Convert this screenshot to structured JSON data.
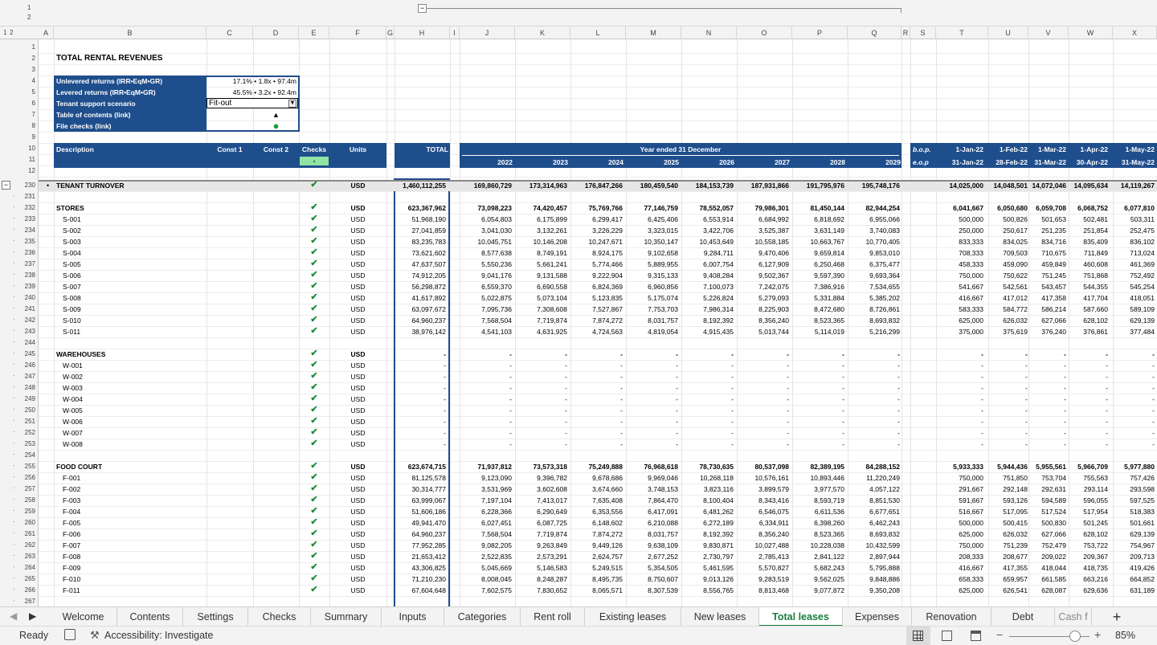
{
  "outline_levels": [
    "1",
    "2"
  ],
  "row_levels": [
    "1",
    "2"
  ],
  "columns": [
    "A",
    "B",
    "C",
    "D",
    "E",
    "F",
    "G",
    "H",
    "I",
    "J",
    "K",
    "L",
    "M",
    "N",
    "O",
    "P",
    "Q",
    "R",
    "S",
    "T",
    "U",
    "V",
    "W",
    "X"
  ],
  "title": "TOTAL RENTAL REVENUES",
  "summary": {
    "rows": [
      {
        "rownum": "4",
        "label": "Unlevered returns (IRR•EqM•GR)",
        "value": "17.1% • 1.8x • 97.4m"
      },
      {
        "rownum": "5",
        "label": "Levered returns (IRR•EqM•GR)",
        "value": "45.5% • 3.2x • 92.4m"
      },
      {
        "rownum": "6",
        "label": "Tenant support scenario",
        "value": "Fit-out"
      },
      {
        "rownum": "7",
        "label": "Table of contents (link)",
        "value": "▲"
      },
      {
        "rownum": "8",
        "label": "File checks (link)",
        "value": "●"
      }
    ]
  },
  "header": {
    "description": "Description",
    "const1": "Const 1",
    "const2": "Const 2",
    "checks": "Checks",
    "units": "Units",
    "total": "TOTAL",
    "year_ended": "Year ended 31 December",
    "check_status": "-",
    "years": [
      "2022",
      "2023",
      "2024",
      "2025",
      "2026",
      "2027",
      "2028",
      "2029"
    ],
    "bop": "b.o.p.",
    "eop": "e.o.p",
    "month_starts": [
      "1-Jan-22",
      "1-Feb-22",
      "1-Mar-22",
      "1-Apr-22",
      "1-May-22"
    ],
    "month_ends": [
      "31-Jan-22",
      "28-Feb-22",
      "31-Mar-22",
      "30-Apr-22",
      "31-May-22"
    ]
  },
  "top_rows": [
    "1",
    "2",
    "3",
    "4",
    "5",
    "6",
    "7",
    "8",
    "9",
    "10",
    "11",
    "12"
  ],
  "rows": [
    {
      "n": "230",
      "label": "TENANT TURNOVER",
      "bold": true,
      "bullet": true,
      "check": true,
      "units": "USD",
      "total": "1,460,112,255",
      "years": [
        "169,860,729",
        "173,314,963",
        "176,847,266",
        "180,459,540",
        "184,153,739",
        "187,931,866",
        "191,795,976",
        "195,748,176"
      ],
      "months": [
        "14,025,000",
        "14,048,501",
        "14,072,046",
        "14,095,634",
        "14,119,267"
      ]
    },
    {
      "n": "231"
    },
    {
      "n": "232",
      "label": "STORES",
      "bold": true,
      "check": true,
      "units": "USD",
      "total": "623,367,962",
      "years": [
        "73,098,223",
        "74,420,457",
        "75,769,766",
        "77,146,759",
        "78,552,057",
        "79,986,301",
        "81,450,144",
        "82,944,254"
      ],
      "months": [
        "6,041,667",
        "6,050,680",
        "6,059,708",
        "6,068,752",
        "6,077,810"
      ]
    },
    {
      "n": "233",
      "label": "S-001",
      "check": true,
      "units": "USD",
      "total": "51,968,190",
      "years": [
        "6,054,803",
        "6,175,899",
        "6,299,417",
        "6,425,406",
        "6,553,914",
        "6,684,992",
        "6,818,692",
        "6,955,066"
      ],
      "months": [
        "500,000",
        "500,826",
        "501,653",
        "502,481",
        "503,311"
      ]
    },
    {
      "n": "234",
      "label": "S-002",
      "check": true,
      "units": "USD",
      "total": "27,041,859",
      "years": [
        "3,041,030",
        "3,132,261",
        "3,226,229",
        "3,323,015",
        "3,422,706",
        "3,525,387",
        "3,631,149",
        "3,740,083"
      ],
      "months": [
        "250,000",
        "250,617",
        "251,235",
        "251,854",
        "252,475"
      ]
    },
    {
      "n": "235",
      "label": "S-003",
      "check": true,
      "units": "USD",
      "total": "83,235,783",
      "years": [
        "10,045,751",
        "10,146,208",
        "10,247,671",
        "10,350,147",
        "10,453,649",
        "10,558,185",
        "10,663,767",
        "10,770,405"
      ],
      "months": [
        "833,333",
        "834,025",
        "834,716",
        "835,409",
        "836,102"
      ]
    },
    {
      "n": "236",
      "label": "S-004",
      "check": true,
      "units": "USD",
      "total": "73,621,602",
      "years": [
        "8,577,638",
        "8,749,191",
        "8,924,175",
        "9,102,658",
        "9,284,711",
        "9,470,406",
        "9,659,814",
        "9,853,010"
      ],
      "months": [
        "708,333",
        "709,503",
        "710,675",
        "711,849",
        "713,024"
      ]
    },
    {
      "n": "237",
      "label": "S-005",
      "check": true,
      "units": "USD",
      "total": "47,637,507",
      "years": [
        "5,550,236",
        "5,661,241",
        "5,774,466",
        "5,889,955",
        "6,007,754",
        "6,127,909",
        "6,250,468",
        "6,375,477"
      ],
      "months": [
        "458,333",
        "459,090",
        "459,849",
        "460,608",
        "461,369"
      ]
    },
    {
      "n": "238",
      "label": "S-006",
      "check": true,
      "units": "USD",
      "total": "74,912,205",
      "years": [
        "9,041,176",
        "9,131,588",
        "9,222,904",
        "9,315,133",
        "9,408,284",
        "9,502,367",
        "9,597,390",
        "9,693,364"
      ],
      "months": [
        "750,000",
        "750,622",
        "751,245",
        "751,868",
        "752,492"
      ]
    },
    {
      "n": "239",
      "label": "S-007",
      "check": true,
      "units": "USD",
      "total": "56,298,872",
      "years": [
        "6,559,370",
        "6,690,558",
        "6,824,369",
        "6,960,856",
        "7,100,073",
        "7,242,075",
        "7,386,916",
        "7,534,655"
      ],
      "months": [
        "541,667",
        "542,561",
        "543,457",
        "544,355",
        "545,254"
      ]
    },
    {
      "n": "240",
      "label": "S-008",
      "check": true,
      "units": "USD",
      "total": "41,617,892",
      "years": [
        "5,022,875",
        "5,073,104",
        "5,123,835",
        "5,175,074",
        "5,226,824",
        "5,279,093",
        "5,331,884",
        "5,385,202"
      ],
      "months": [
        "416,667",
        "417,012",
        "417,358",
        "417,704",
        "418,051"
      ]
    },
    {
      "n": "241",
      "label": "S-009",
      "check": true,
      "units": "USD",
      "total": "63,097,672",
      "years": [
        "7,095,736",
        "7,308,608",
        "7,527,867",
        "7,753,703",
        "7,986,314",
        "8,225,903",
        "8,472,680",
        "8,726,861"
      ],
      "months": [
        "583,333",
        "584,772",
        "586,214",
        "587,660",
        "589,109"
      ]
    },
    {
      "n": "242",
      "label": "S-010",
      "check": true,
      "units": "USD",
      "total": "64,960,237",
      "years": [
        "7,568,504",
        "7,719,874",
        "7,874,272",
        "8,031,757",
        "8,192,392",
        "8,356,240",
        "8,523,365",
        "8,693,832"
      ],
      "months": [
        "625,000",
        "626,032",
        "627,066",
        "628,102",
        "629,139"
      ]
    },
    {
      "n": "243",
      "label": "S-011",
      "check": true,
      "units": "USD",
      "total": "38,976,142",
      "years": [
        "4,541,103",
        "4,631,925",
        "4,724,563",
        "4,819,054",
        "4,915,435",
        "5,013,744",
        "5,114,019",
        "5,216,299"
      ],
      "months": [
        "375,000",
        "375,619",
        "376,240",
        "376,861",
        "377,484"
      ]
    },
    {
      "n": "244"
    },
    {
      "n": "245",
      "label": "WAREHOUSES",
      "bold": true,
      "check": true,
      "units": "USD",
      "total": "-",
      "years": [
        "-",
        "-",
        "-",
        "-",
        "-",
        "-",
        "-",
        "-"
      ],
      "months": [
        "-",
        "-",
        "-",
        "-",
        "-"
      ]
    },
    {
      "n": "246",
      "label": "W-001",
      "indent": true,
      "check": true,
      "units": "USD",
      "total": "-",
      "years": [
        "-",
        "-",
        "-",
        "-",
        "-",
        "-",
        "-",
        "-"
      ],
      "months": [
        "-",
        "-",
        "-",
        "-",
        "-"
      ]
    },
    {
      "n": "247",
      "label": "W-002",
      "indent": true,
      "check": true,
      "units": "USD",
      "total": "-",
      "years": [
        "-",
        "-",
        "-",
        "-",
        "-",
        "-",
        "-",
        "-"
      ],
      "months": [
        "-",
        "-",
        "-",
        "-",
        "-"
      ]
    },
    {
      "n": "248",
      "label": "W-003",
      "indent": true,
      "check": true,
      "units": "USD",
      "total": "-",
      "years": [
        "-",
        "-",
        "-",
        "-",
        "-",
        "-",
        "-",
        "-"
      ],
      "months": [
        "-",
        "-",
        "-",
        "-",
        "-"
      ]
    },
    {
      "n": "249",
      "label": "W-004",
      "indent": true,
      "check": true,
      "units": "USD",
      "total": "-",
      "years": [
        "-",
        "-",
        "-",
        "-",
        "-",
        "-",
        "-",
        "-"
      ],
      "months": [
        "-",
        "-",
        "-",
        "-",
        "-"
      ]
    },
    {
      "n": "250",
      "label": "W-005",
      "indent": true,
      "check": true,
      "units": "USD",
      "total": "-",
      "years": [
        "-",
        "-",
        "-",
        "-",
        "-",
        "-",
        "-",
        "-"
      ],
      "months": [
        "-",
        "-",
        "-",
        "-",
        "-"
      ]
    },
    {
      "n": "251",
      "label": "W-006",
      "indent": true,
      "check": true,
      "units": "USD",
      "total": "-",
      "years": [
        "-",
        "-",
        "-",
        "-",
        "-",
        "-",
        "-",
        "-"
      ],
      "months": [
        "-",
        "-",
        "-",
        "-",
        "-"
      ]
    },
    {
      "n": "252",
      "label": "W-007",
      "indent": true,
      "check": true,
      "units": "USD",
      "total": "-",
      "years": [
        "-",
        "-",
        "-",
        "-",
        "-",
        "-",
        "-",
        "-"
      ],
      "months": [
        "-",
        "-",
        "-",
        "-",
        "-"
      ]
    },
    {
      "n": "253",
      "label": "W-008",
      "indent": true,
      "check": true,
      "units": "USD",
      "total": "-",
      "years": [
        "-",
        "-",
        "-",
        "-",
        "-",
        "-",
        "-",
        "-"
      ],
      "months": [
        "-",
        "-",
        "-",
        "-",
        "-"
      ]
    },
    {
      "n": "254"
    },
    {
      "n": "255",
      "label": "FOOD COURT",
      "bold": true,
      "check": true,
      "units": "USD",
      "total": "623,674,715",
      "years": [
        "71,937,812",
        "73,573,318",
        "75,249,888",
        "76,968,618",
        "78,730,635",
        "80,537,098",
        "82,389,195",
        "84,288,152"
      ],
      "months": [
        "5,933,333",
        "5,944,436",
        "5,955,561",
        "5,966,709",
        "5,977,880"
      ]
    },
    {
      "n": "256",
      "label": "F-001",
      "check": true,
      "units": "USD",
      "total": "81,125,578",
      "years": [
        "9,123,090",
        "9,396,782",
        "9,678,686",
        "9,969,046",
        "10,268,118",
        "10,576,161",
        "10,893,446",
        "11,220,249"
      ],
      "months": [
        "750,000",
        "751,850",
        "753,704",
        "755,563",
        "757,426"
      ]
    },
    {
      "n": "257",
      "label": "F-002",
      "check": true,
      "units": "USD",
      "total": "30,314,777",
      "years": [
        "3,531,969",
        "3,602,608",
        "3,674,660",
        "3,748,153",
        "3,823,116",
        "3,899,579",
        "3,977,570",
        "4,057,122"
      ],
      "months": [
        "291,667",
        "292,148",
        "292,631",
        "293,114",
        "293,598"
      ]
    },
    {
      "n": "258",
      "label": "F-003",
      "check": true,
      "units": "USD",
      "total": "63,999,067",
      "years": [
        "7,197,104",
        "7,413,017",
        "7,635,408",
        "7,864,470",
        "8,100,404",
        "8,343,416",
        "8,593,719",
        "8,851,530"
      ],
      "months": [
        "591,667",
        "593,126",
        "594,589",
        "596,055",
        "597,525"
      ]
    },
    {
      "n": "259",
      "label": "F-004",
      "check": true,
      "units": "USD",
      "total": "51,606,186",
      "years": [
        "6,228,366",
        "6,290,649",
        "6,353,556",
        "6,417,091",
        "6,481,262",
        "6,546,075",
        "6,611,536",
        "6,677,651"
      ],
      "months": [
        "516,667",
        "517,095",
        "517,524",
        "517,954",
        "518,383"
      ]
    },
    {
      "n": "260",
      "label": "F-005",
      "check": true,
      "units": "USD",
      "total": "49,941,470",
      "years": [
        "6,027,451",
        "6,087,725",
        "6,148,602",
        "6,210,088",
        "6,272,189",
        "6,334,911",
        "6,398,260",
        "6,462,243"
      ],
      "months": [
        "500,000",
        "500,415",
        "500,830",
        "501,245",
        "501,661"
      ]
    },
    {
      "n": "261",
      "label": "F-006",
      "check": true,
      "units": "USD",
      "total": "64,960,237",
      "years": [
        "7,568,504",
        "7,719,874",
        "7,874,272",
        "8,031,757",
        "8,192,392",
        "8,356,240",
        "8,523,365",
        "8,693,832"
      ],
      "months": [
        "625,000",
        "626,032",
        "627,066",
        "628,102",
        "629,139"
      ]
    },
    {
      "n": "262",
      "label": "F-007",
      "check": true,
      "units": "USD",
      "total": "77,952,285",
      "years": [
        "9,082,205",
        "9,263,849",
        "9,449,126",
        "9,638,109",
        "9,830,871",
        "10,027,488",
        "10,228,038",
        "10,432,599"
      ],
      "months": [
        "750,000",
        "751,239",
        "752,479",
        "753,722",
        "754,967"
      ]
    },
    {
      "n": "263",
      "label": "F-008",
      "check": true,
      "units": "USD",
      "total": "21,653,412",
      "years": [
        "2,522,835",
        "2,573,291",
        "2,624,757",
        "2,677,252",
        "2,730,797",
        "2,785,413",
        "2,841,122",
        "2,897,944"
      ],
      "months": [
        "208,333",
        "208,677",
        "209,022",
        "209,367",
        "209,713"
      ]
    },
    {
      "n": "264",
      "label": "F-009",
      "check": true,
      "units": "USD",
      "total": "43,306,825",
      "years": [
        "5,045,669",
        "5,146,583",
        "5,249,515",
        "5,354,505",
        "5,461,595",
        "5,570,827",
        "5,682,243",
        "5,795,888"
      ],
      "months": [
        "416,667",
        "417,355",
        "418,044",
        "418,735",
        "419,426"
      ]
    },
    {
      "n": "265",
      "label": "F-010",
      "check": true,
      "units": "USD",
      "total": "71,210,230",
      "years": [
        "8,008,045",
        "8,248,287",
        "8,495,735",
        "8,750,607",
        "9,013,126",
        "9,283,519",
        "9,562,025",
        "9,848,886"
      ],
      "months": [
        "658,333",
        "659,957",
        "661,585",
        "663,216",
        "664,852"
      ]
    },
    {
      "n": "266",
      "label": "F-011",
      "check": true,
      "units": "USD",
      "total": "67,604,648",
      "years": [
        "7,602,575",
        "7,830,652",
        "8,065,571",
        "8,307,539",
        "8,556,765",
        "8,813,468",
        "9,077,872",
        "9,350,208"
      ],
      "months": [
        "625,000",
        "626,541",
        "628,087",
        "629,636",
        "631,189"
      ]
    },
    {
      "n": "267"
    }
  ],
  "tabs": [
    "Welcome",
    "Contents",
    "Settings",
    "Checks",
    "Summary",
    "Inputs",
    "Categories",
    "Rent roll",
    "Existing leases",
    "New leases",
    "Total leases",
    "Expenses",
    "Renovation",
    "Debt",
    "Cash f"
  ],
  "active_tab": "Total leases",
  "status": {
    "ready": "Ready",
    "accessibility": "Accessibility: Investigate",
    "zoom": "85%",
    "zoom_level": 0.85
  },
  "colors": {
    "header_navy": "#1f4e8c",
    "check_green": "#1e8b3a",
    "active_tab": "#1a7d3c"
  }
}
